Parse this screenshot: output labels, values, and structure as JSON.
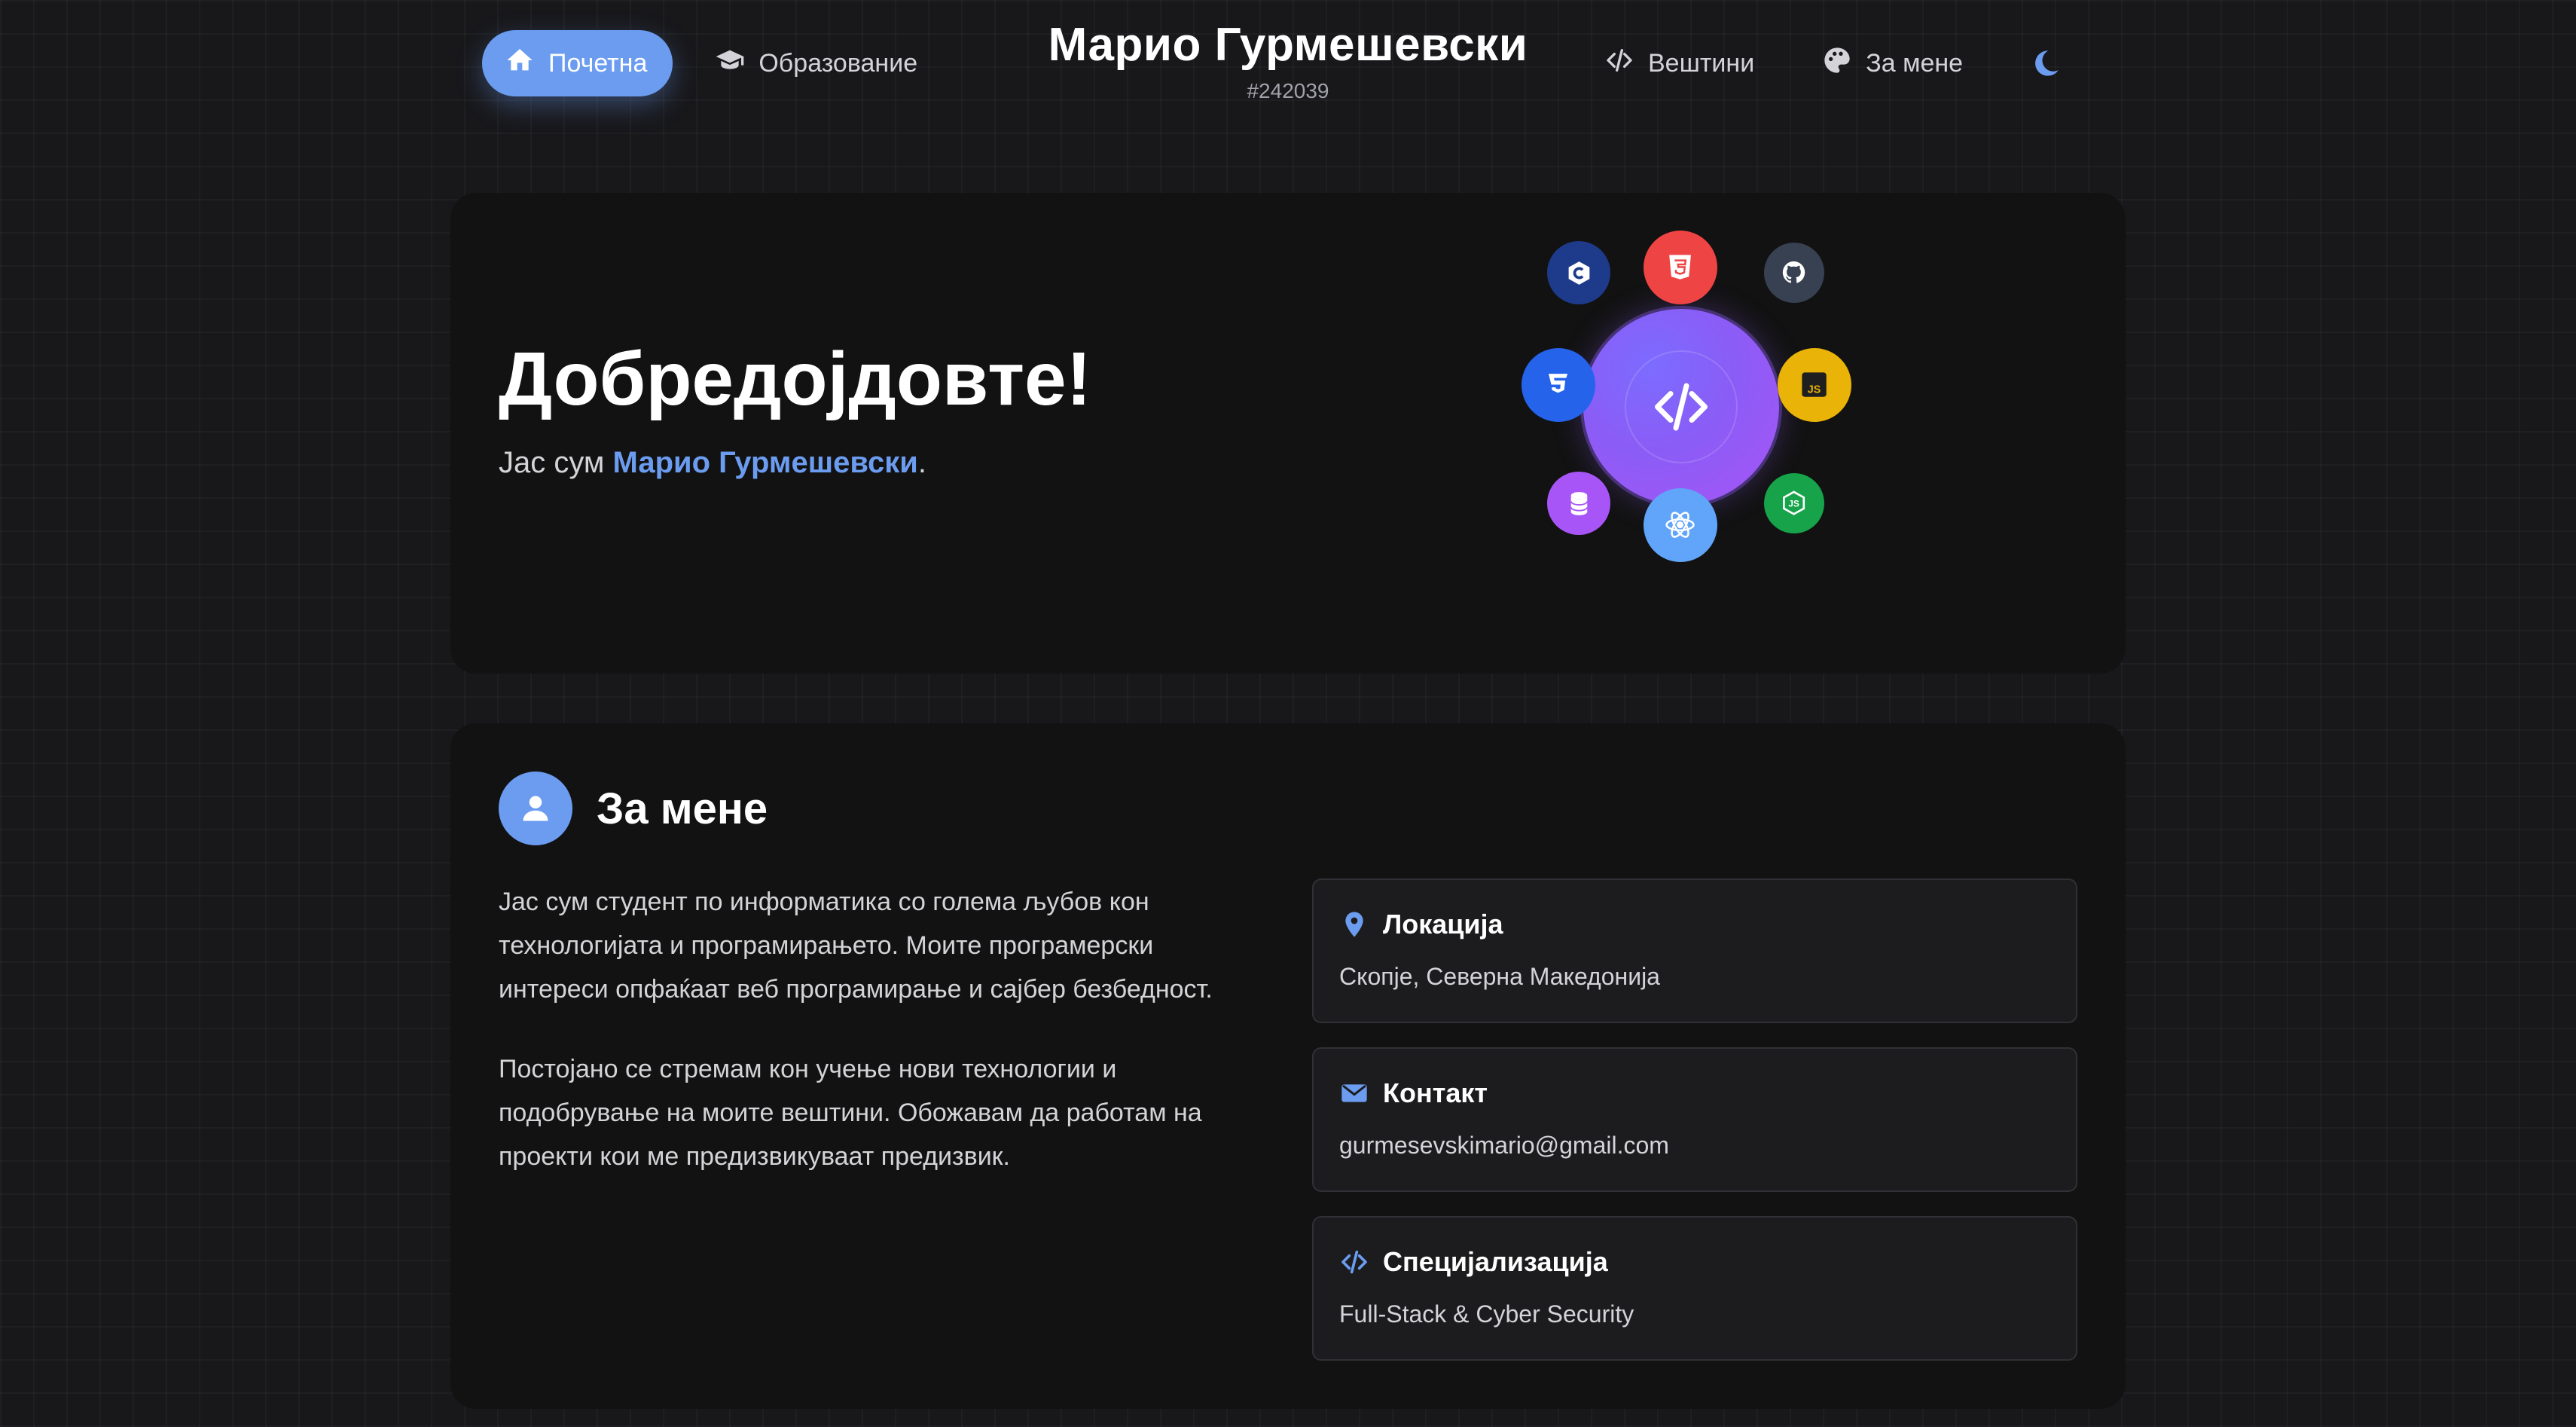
{
  "nav": {
    "home": "Почетна",
    "education": "Образование",
    "skills": "Вештини",
    "about": "За мене"
  },
  "brand": {
    "name": "Марио Гурмешевски",
    "id": "#242039"
  },
  "hero": {
    "title": "Добредојдовте!",
    "intro_prefix": "Јас сум ",
    "intro_name": "Марио Гурмешевски",
    "intro_suffix": "."
  },
  "tech_icons": [
    "c-sharp-icon",
    "html5-icon",
    "github-icon",
    "css3-icon",
    "javascript-icon",
    "database-icon",
    "react-icon",
    "nodejs-icon",
    "code-icon"
  ],
  "about": {
    "title": "За мене",
    "paragraph1": "Јас сум студент по информатика со голема љубов кон технологијата и програмирањето. Моите програмерски интереси опфаќаат веб програмирање и сајбер безбедност.",
    "paragraph2": "Постојано се стремам кон учење нови технологии и подобрување на моите вештини. Обожавам да работам на проекти кои ме предизвикуваат предизвик.",
    "cards": [
      {
        "label": "Локација",
        "value": "Скопје, Северна Македонија"
      },
      {
        "label": "Контакт",
        "value": "gurmesevskimario@gmail.com"
      },
      {
        "label": "Специјализација",
        "value": "Full-Stack & Cyber Security"
      }
    ]
  },
  "colors": {
    "accent": "#6b9cf0",
    "background": "#18181b",
    "card": "#121212"
  }
}
